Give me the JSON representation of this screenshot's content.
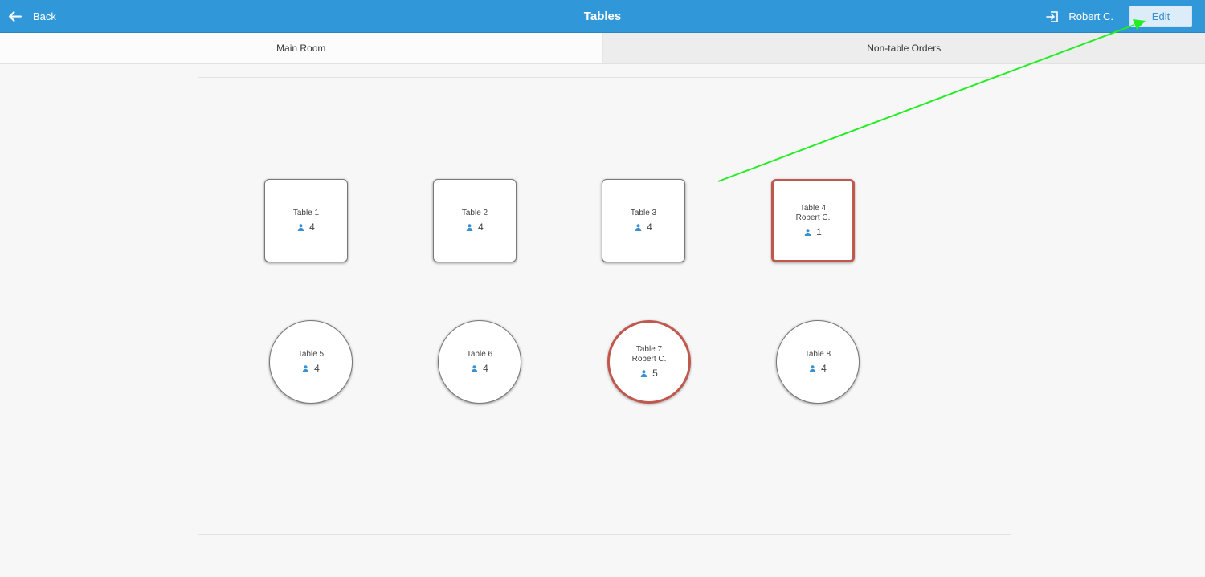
{
  "header": {
    "back_label": "Back",
    "title": "Tables",
    "user_name": "Robert C.",
    "edit_label": "Edit",
    "back_icon": "arrow-left-icon",
    "user_icon": "sign-in-icon"
  },
  "tabs": [
    {
      "label": "Main Room",
      "active": true
    },
    {
      "label": "Non-table Orders",
      "active": false
    }
  ],
  "tables": [
    {
      "name": "Table 1",
      "waiter": "",
      "guests": "4",
      "shape": "square",
      "occupied": false
    },
    {
      "name": "Table 2",
      "waiter": "",
      "guests": "4",
      "shape": "square",
      "occupied": false
    },
    {
      "name": "Table 3",
      "waiter": "",
      "guests": "4",
      "shape": "square",
      "occupied": false
    },
    {
      "name": "Table 4",
      "waiter": "Robert C.",
      "guests": "1",
      "shape": "square",
      "occupied": true
    },
    {
      "name": "Table 5",
      "waiter": "",
      "guests": "4",
      "shape": "round",
      "occupied": false
    },
    {
      "name": "Table 6",
      "waiter": "",
      "guests": "4",
      "shape": "round",
      "occupied": false
    },
    {
      "name": "Table 7",
      "waiter": "Robert C.",
      "guests": "5",
      "shape": "round",
      "occupied": true
    },
    {
      "name": "Table 8",
      "waiter": "",
      "guests": "4",
      "shape": "round",
      "occupied": false
    }
  ],
  "colors": {
    "header": "#3098d8",
    "occupied_border": "#c0584e",
    "guest_icon": "#3a8fd0",
    "annotation_arrow": "#22ee22"
  }
}
